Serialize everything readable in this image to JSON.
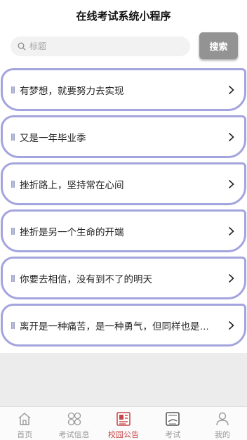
{
  "app": {
    "title": "在线考试系统小程序"
  },
  "search": {
    "placeholder": "标题",
    "button_label": "搜索"
  },
  "notices": [
    {
      "title": "有梦想，就要努力去实现"
    },
    {
      "title": "又是一年毕业季"
    },
    {
      "title": "挫折路上，坚持常在心间"
    },
    {
      "title": "挫折是另一个生命的开端"
    },
    {
      "title": "你要去相信，没有到不了的明天"
    },
    {
      "title": "离开是一种痛苦，是一种勇气，但同样也是一种保护"
    }
  ],
  "tabbar": {
    "active": "校园公告",
    "items": [
      {
        "label": "首页",
        "icon": "home-icon"
      },
      {
        "label": "考试信息",
        "icon": "grid-icon"
      },
      {
        "label": "校园公告",
        "icon": "newspaper-icon"
      },
      {
        "label": "考试",
        "icon": "exam-paper-icon"
      },
      {
        "label": "我的",
        "icon": "user-icon"
      }
    ]
  },
  "colors": {
    "accent": "#c64444",
    "card_border": "#a4a4de",
    "search_button": "#939393"
  }
}
